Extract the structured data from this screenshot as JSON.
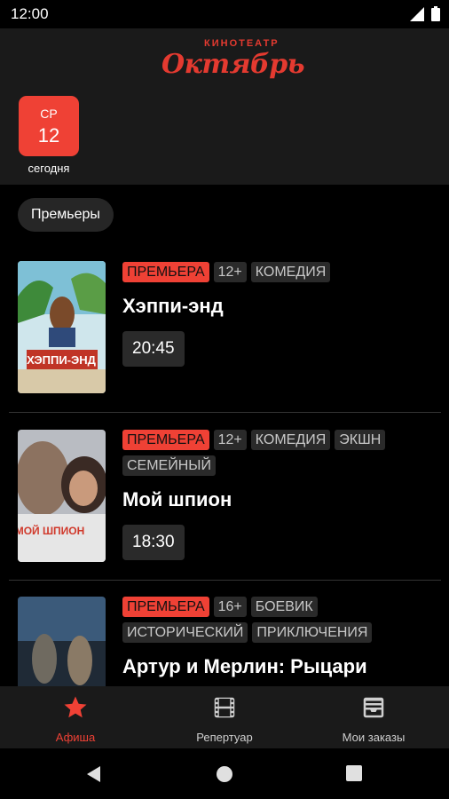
{
  "status": {
    "time": "12:00"
  },
  "header": {
    "logo_small": "КИНОТЕАТР",
    "logo_big": "Октябрь",
    "date": {
      "dow": "СР",
      "day": "12",
      "label": "сегодня"
    }
  },
  "filter": {
    "chip": "Премьеры"
  },
  "movies": [
    {
      "tags": [
        "ПРЕМЬЕРА",
        "12+",
        "КОМЕДИЯ"
      ],
      "title": "Хэппи-энд",
      "times": [
        "20:45"
      ],
      "poster_colors": [
        "#6fb0c8",
        "#c9a35a",
        "#b0332a"
      ],
      "poster_text": "ХЭППИ-ЭНД"
    },
    {
      "tags": [
        "ПРЕМЬЕРА",
        "12+",
        "КОМЕДИЯ",
        "ЭКШН",
        "СЕМЕЙНЫЙ"
      ],
      "title": "Мой шпион",
      "times": [
        "18:30"
      ],
      "poster_colors": [
        "#8a8f96",
        "#c8b49a",
        "#3b3b40"
      ],
      "poster_text": "МОЙ ШПИОН"
    },
    {
      "tags": [
        "ПРЕМЬЕРА",
        "16+",
        "БОЕВИК",
        "ИСТОРИЧЕСКИЙ",
        "ПРИКЛЮЧЕНИЯ"
      ],
      "title": "Артур и Мерлин: Рыцари",
      "times": [],
      "poster_colors": [
        "#3d5a78",
        "#7a8ea0",
        "#2b2f36"
      ],
      "poster_text": ""
    }
  ],
  "bottom_nav": [
    {
      "label": "Афиша",
      "icon": "star-icon",
      "active": true
    },
    {
      "label": "Репертуар",
      "icon": "film-icon",
      "active": false
    },
    {
      "label": "Мои заказы",
      "icon": "orders-icon",
      "active": false
    }
  ],
  "colors": {
    "accent": "#ef4135",
    "background": "#000000",
    "surface": "#1a1a1a",
    "chip": "#2a2a2a"
  }
}
